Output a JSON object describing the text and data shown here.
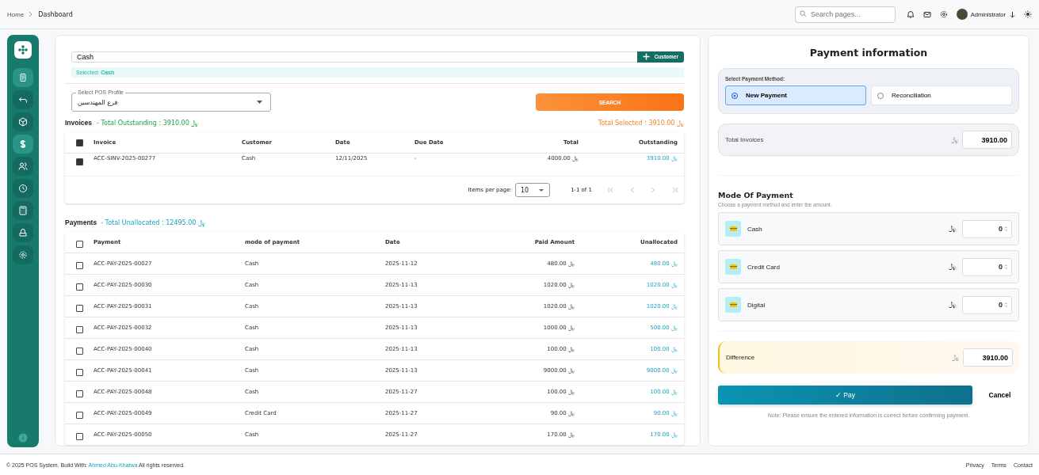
{
  "breadcrumb": [
    "Home",
    "Dashboard"
  ],
  "topbar": {
    "search_placeholder": "Search pages...",
    "user_name": "Administrator"
  },
  "sidebar": {
    "items": [
      {
        "selected": true
      },
      {
        "selected": false
      },
      {
        "selected": false
      },
      {
        "selected": true
      },
      {
        "selected": false
      },
      {
        "selected": false
      },
      {
        "selected": false
      },
      {
        "selected": false
      },
      {
        "selected": false
      }
    ]
  },
  "customer_field": {
    "value": "Cash"
  },
  "add_customer_button": "Customer",
  "selected_banner": "Selected: **Cash**",
  "pos_profile": {
    "label": "Select POS Profile",
    "value": "فرع المهندسين"
  },
  "search_button": "SEARCH",
  "invoices": {
    "title": "Invoices",
    "total": "- Total Outstanding : 3910.00 ﷼",
    "selected_total": "Total Selected :  3910.00 ﷼",
    "header_checked": true,
    "columns": [
      "Invoice",
      "Customer",
      "Date",
      "Due Date",
      "Total",
      "Outstanding"
    ],
    "rows": [
      {
        "checked": true,
        "cells": [
          "ACC-SINV-2025-00277",
          "Cash",
          "12/11/2025",
          "-",
          "4000.00 ﷼",
          "3910.00 ﷼"
        ]
      }
    ],
    "pagination": {
      "label": "Items per page:",
      "page_size": "10",
      "range": "1-1 of 1"
    }
  },
  "payments": {
    "title": "Payments",
    "total": "- Total Unallocated : 12495.00 ﷼",
    "header_checked": false,
    "columns": [
      "Payment",
      "mode of payment",
      "Date",
      "Paid Amount",
      "Unallocated"
    ],
    "rows": [
      {
        "checked": false,
        "cells": [
          "ACC-PAY-2025-00027",
          "Cash",
          "2025-11-12",
          "480.00 ﷼",
          "480.00 ﷼"
        ]
      },
      {
        "checked": false,
        "cells": [
          "ACC-PAY-2025-00030",
          "Cash",
          "2025-11-13",
          "1020.00 ﷼",
          "1020.00 ﷼"
        ]
      },
      {
        "checked": false,
        "cells": [
          "ACC-PAY-2025-00031",
          "Cash",
          "2025-11-13",
          "1020.00 ﷼",
          "1020.00 ﷼"
        ]
      },
      {
        "checked": false,
        "cells": [
          "ACC-PAY-2025-00032",
          "Cash",
          "2025-11-13",
          "1000.00 ﷼",
          "500.00 ﷼"
        ]
      },
      {
        "checked": false,
        "cells": [
          "ACC-PAY-2025-00040",
          "Cash",
          "2025-11-13",
          "100.00 ﷼",
          "100.00 ﷼"
        ]
      },
      {
        "checked": false,
        "cells": [
          "ACC-PAY-2025-00041",
          "Cash",
          "2025-11-13",
          "9000.00 ﷼",
          "9000.00 ﷼"
        ]
      },
      {
        "checked": false,
        "cells": [
          "ACC-PAY-2025-00048",
          "Cash",
          "2025-11-27",
          "100.00 ﷼",
          "100.00 ﷼"
        ]
      },
      {
        "checked": false,
        "cells": [
          "ACC-PAY-2025-00049",
          "Credit Card",
          "2025-11-27",
          "90.00 ﷼",
          "90.00 ﷼"
        ]
      },
      {
        "checked": false,
        "cells": [
          "ACC-PAY-2025-00050",
          "Cash",
          "2025-11-27",
          "170.00 ﷼",
          "170.00 ﷼"
        ]
      }
    ]
  },
  "payment_panel": {
    "title": "Payment information",
    "method_label": "Select Payment Method:",
    "methods": [
      {
        "label": "New Payment",
        "selected": true
      },
      {
        "label": "Reconciliation",
        "selected": false
      }
    ],
    "total_invoices": {
      "label": "Total Invoices",
      "currency": "﷼",
      "value": "3910.00"
    },
    "mode_title": "Mode Of Payment",
    "mode_subtitle": "Choose a payment method and enter the amount.",
    "modes": [
      {
        "name": "Cash",
        "currency": "﷼",
        "value": "0"
      },
      {
        "name": "Credit Card",
        "currency": "﷼",
        "value": "0"
      },
      {
        "name": "Digital",
        "currency": "﷼",
        "value": "0"
      }
    ],
    "difference": {
      "label": "Difference",
      "currency": "﷼",
      "value": "3910.00"
    },
    "pay_button": "✓ Pay",
    "cancel_button": "Cancel",
    "note": "Note: Please ensure the entered information is correct before confirming payment."
  },
  "footer": {
    "before": "© 2025 POS System. Build With:",
    "link": "Ahmed Abu-Khatwa",
    "after": "All rights reserved.",
    "links": [
      "Privacy",
      "Terms",
      "Contact"
    ]
  }
}
